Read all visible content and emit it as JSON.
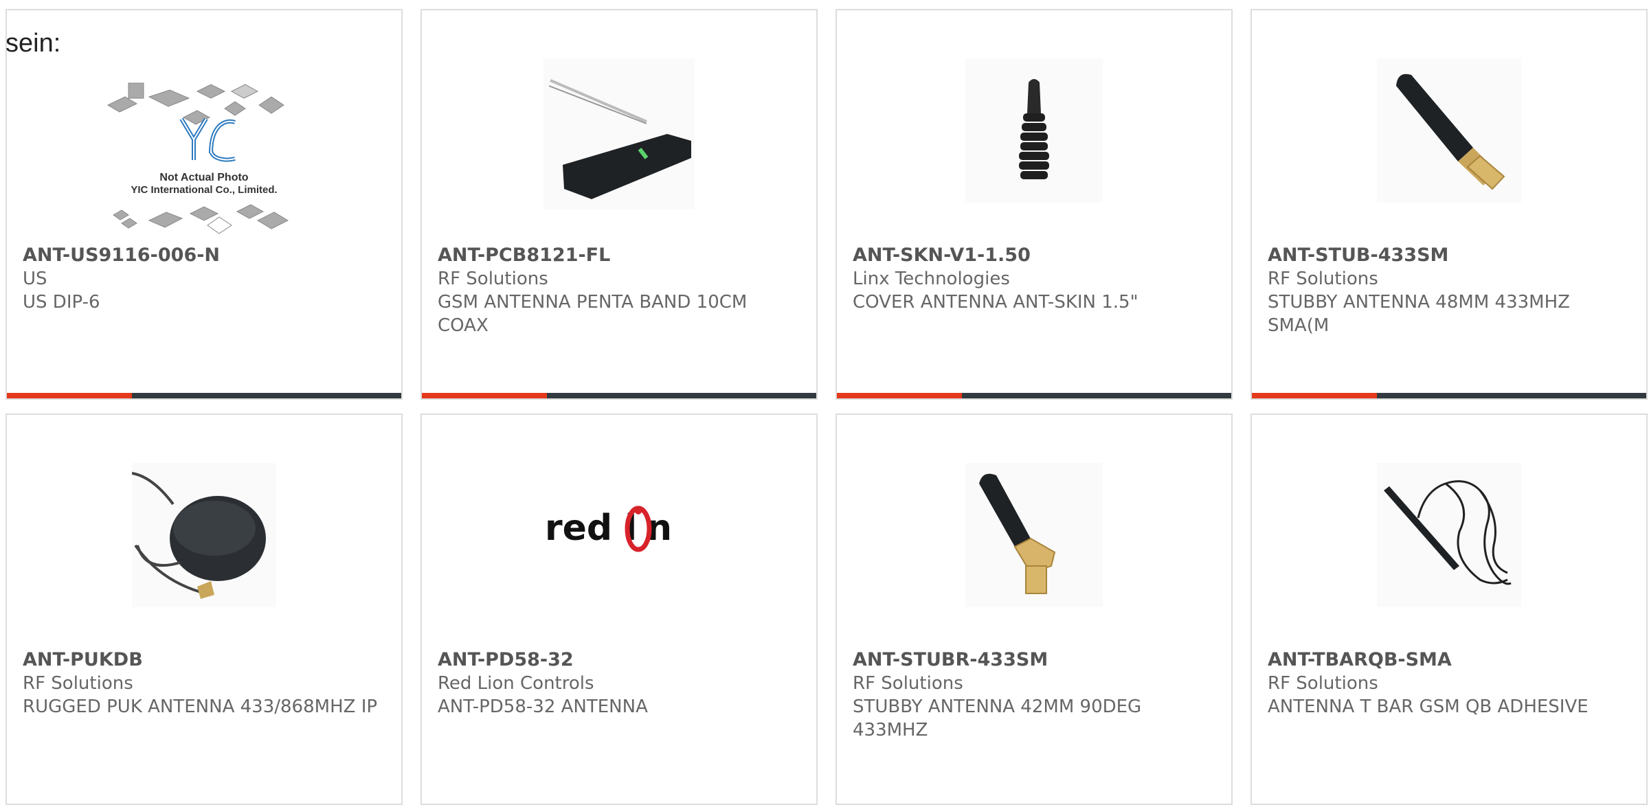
{
  "lead_text": "sein:",
  "products": [
    {
      "part_number": "ANT-US9116-006-N",
      "manufacturer": "US",
      "description": "US DIP-6",
      "image": "placeholder-photo",
      "image_text": {
        "line1": "Not Actual Photo",
        "line2": "YIC International Co., Limited.",
        "logo": "YIC"
      }
    },
    {
      "part_number": "ANT-PCB8121-FL",
      "manufacturer": "RF Solutions",
      "description": "GSM ANTENNA PENTA BAND 10CM COAX",
      "image": "pcb-antenna-photo"
    },
    {
      "part_number": "ANT-SKN-V1-1.50",
      "manufacturer": "Linx Technologies",
      "description": "COVER ANTENNA ANT-SKIN 1.5\"",
      "image": "antenna-skin-photo"
    },
    {
      "part_number": "ANT-STUB-433SM",
      "manufacturer": "RF Solutions",
      "description": "STUBBY ANTENNA 48MM 433MHZ SMA(M",
      "image": "stubby-antenna-photo"
    },
    {
      "part_number": "ANT-PUKDB",
      "manufacturer": "RF Solutions",
      "description": "RUGGED PUK ANTENNA 433/868MHZ IP",
      "image": "puck-antenna-photo"
    },
    {
      "part_number": "ANT-PD58-32",
      "manufacturer": "Red Lion Controls",
      "description": "ANT-PD58-32 ANTENNA",
      "image": "red-lion-logo"
    },
    {
      "part_number": "ANT-STUBR-433SM",
      "manufacturer": "RF Solutions",
      "description": "STUBBY ANTENNA 42MM 90DEG 433MHZ",
      "image": "right-angle-stubby-antenna-photo"
    },
    {
      "part_number": "ANT-TBARQB-SMA",
      "manufacturer": "RF Solutions",
      "description": "ANTENNA T BAR GSM QB ADHESIVE",
      "image": "t-bar-antenna-photo"
    }
  ],
  "colors": {
    "accent": "#e5391b",
    "bar": "#333a3f",
    "border": "#dddddd",
    "text": "#666666"
  }
}
